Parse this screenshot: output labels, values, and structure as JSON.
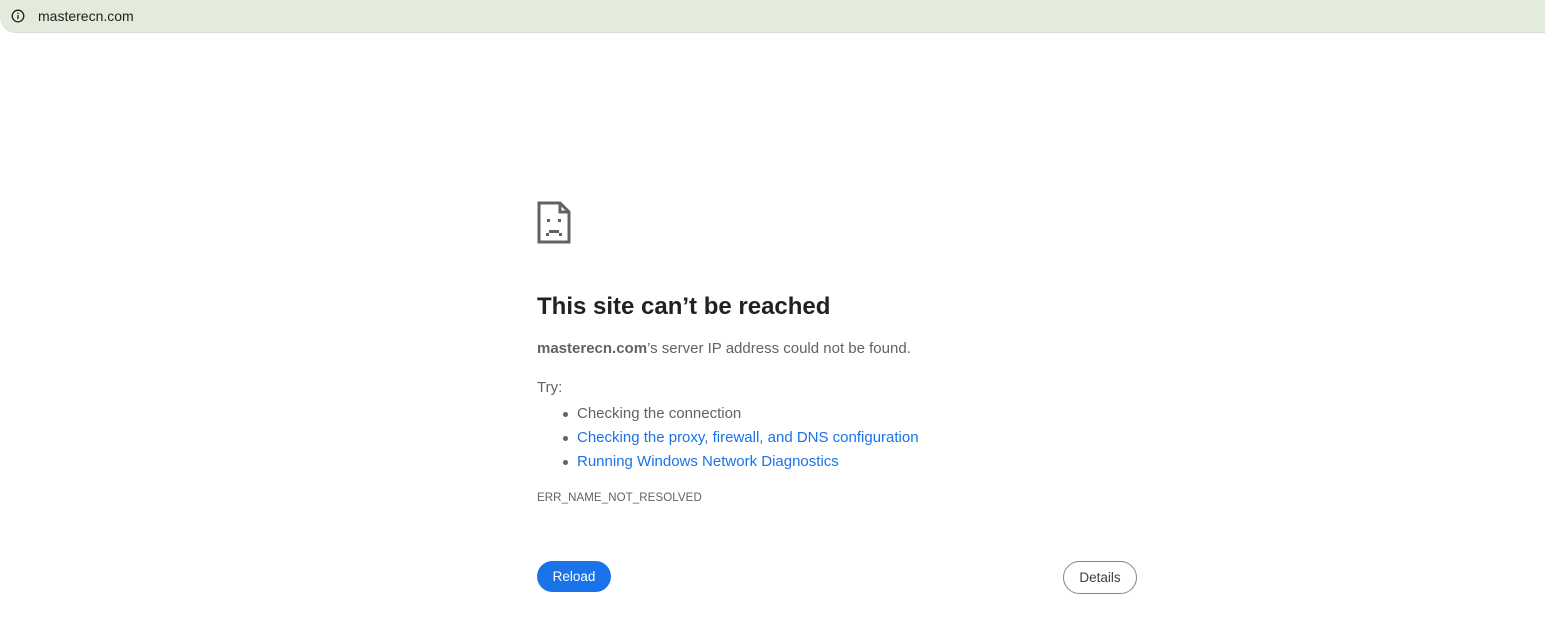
{
  "address_bar": {
    "url": "masterecn.com",
    "site_info_icon": "info-circle-icon"
  },
  "error": {
    "icon": "sad-page-icon",
    "title": "This site can’t be reached",
    "message_host": "masterecn.com",
    "message_rest": "’s server IP address could not be found.",
    "try_label": "Try:",
    "suggestions": [
      {
        "label": "Checking the connection",
        "is_link": false
      },
      {
        "label": "Checking the proxy, firewall, and DNS configuration",
        "is_link": true
      },
      {
        "label": "Running Windows Network Diagnostics",
        "is_link": true
      }
    ],
    "code": "ERR_NAME_NOT_RESOLVED"
  },
  "buttons": {
    "reload_label": "Reload",
    "details_label": "Details"
  },
  "colors": {
    "accent": "#1a73e8",
    "address_bar_bg": "#e3ecdc",
    "text_secondary": "#5f6368",
    "title_text": "#202124"
  }
}
